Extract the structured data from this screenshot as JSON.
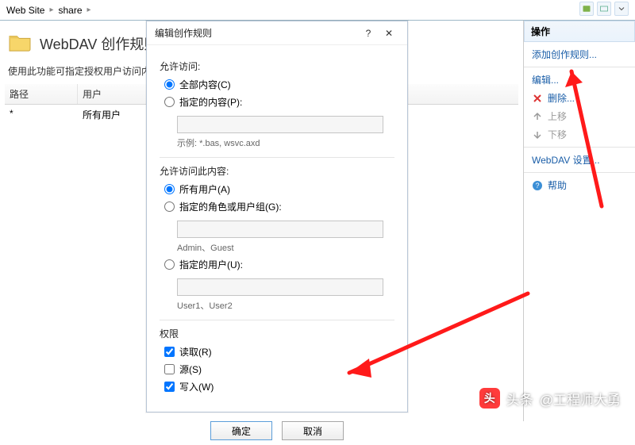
{
  "breadcrumb": {
    "items": [
      "Web Site",
      "share"
    ],
    "sep": "▸"
  },
  "page": {
    "title": "WebDAV 创作规则",
    "description": "使用此功能可指定授权用户访问内容的规则。"
  },
  "table": {
    "headers": [
      "路径",
      "用户"
    ],
    "rows": [
      {
        "path": "*",
        "user": "所有用户"
      }
    ]
  },
  "dialog": {
    "title": "编辑创作规则",
    "help_char": "?",
    "close_char": "✕",
    "group_access": {
      "title": "允许访问:",
      "opt_all": "全部内容(C)",
      "opt_spec": "指定的内容(P):",
      "hint": "示例: *.bas, wsvc.axd"
    },
    "group_users": {
      "title": "允许访问此内容:",
      "opt_all": "所有用户(A)",
      "opt_roles": "指定的角色或用户组(G):",
      "roles_hint": "Admin、Guest",
      "opt_users": "指定的用户(U):",
      "users_hint": "User1、User2"
    },
    "group_perms": {
      "title": "权限",
      "read": "读取(R)",
      "source": "源(S)",
      "write": "写入(W)"
    },
    "buttons": {
      "ok": "确定",
      "cancel": "取消"
    }
  },
  "actions": {
    "title": "操作",
    "add_rule": "添加创作规则...",
    "edit": "编辑...",
    "delete": "删除...",
    "move_up": "上移",
    "move_down": "下移",
    "settings": "WebDAV 设置...",
    "help": "帮助"
  },
  "watermark": {
    "prefix": "头条",
    "at": "@工程师大勇"
  }
}
